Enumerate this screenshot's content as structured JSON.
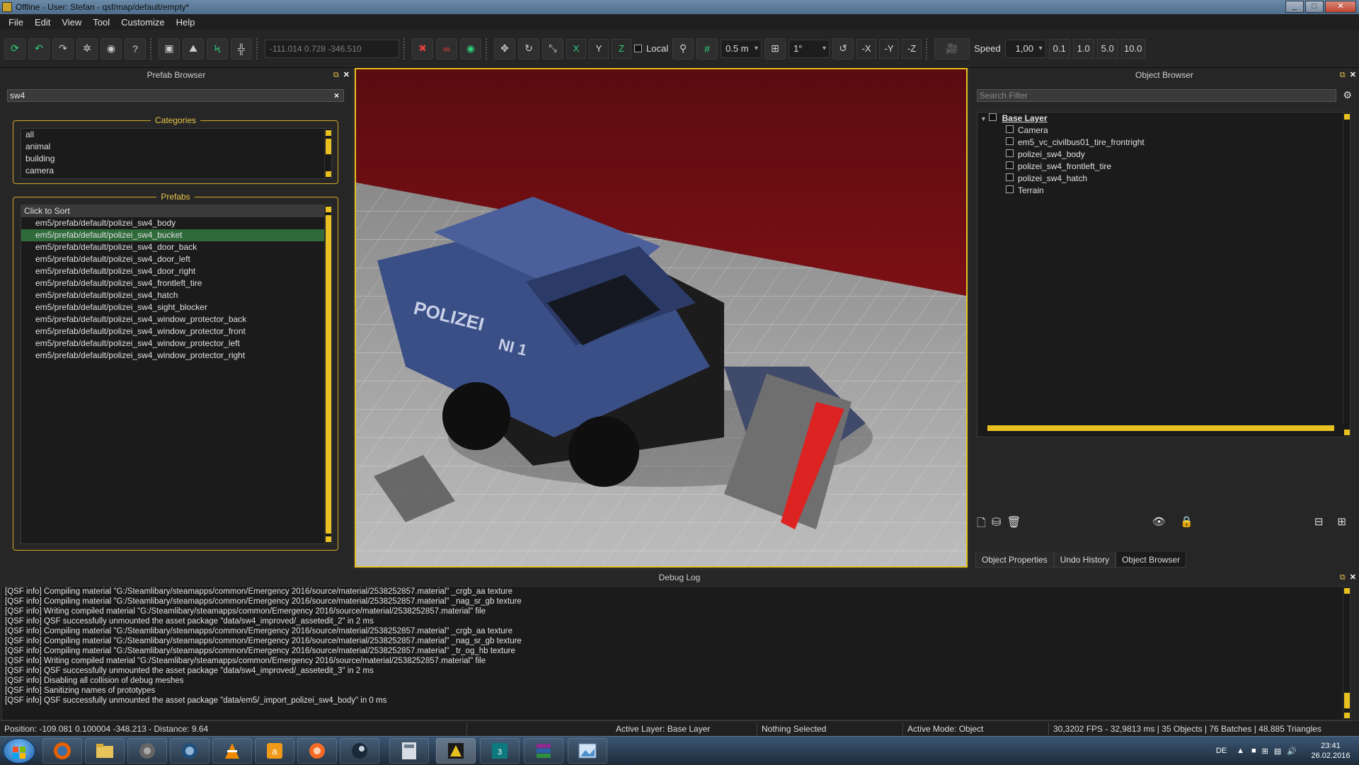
{
  "window": {
    "title": "Offline - User: Stefan - qsf/map/default/empty*",
    "minimize": "_",
    "maximize": "□",
    "close": "✕"
  },
  "menu": [
    "File",
    "Edit",
    "View",
    "Tool",
    "Customize",
    "Help"
  ],
  "toolbar": {
    "coordinates": "-111.014 0.728 -346.510",
    "axis_x": "X",
    "axis_y": "Y",
    "axis_z": "Z",
    "local_label": "Local",
    "grid_size": "0.5 m",
    "angle_snap": "1°",
    "neg_x": "-X",
    "neg_y": "-Y",
    "neg_z": "-Z",
    "speed_label": "Speed",
    "speed_value": "1,00",
    "speed_presets": [
      "0.1",
      "1.0",
      "5.0",
      "10.0"
    ]
  },
  "prefab_browser": {
    "title": "Prefab Browser",
    "search_value": "sw4",
    "categories_label": "Categories",
    "categories": [
      "all",
      "animal",
      "building",
      "camera"
    ],
    "prefabs_label": "Prefabs",
    "sort_header": "Click to Sort",
    "prefabs": [
      "em5/prefab/default/polizei_sw4_body",
      "em5/prefab/default/polizei_sw4_bucket",
      "em5/prefab/default/polizei_sw4_door_back",
      "em5/prefab/default/polizei_sw4_door_left",
      "em5/prefab/default/polizei_sw4_door_right",
      "em5/prefab/default/polizei_sw4_frontleft_tire",
      "em5/prefab/default/polizei_sw4_hatch",
      "em5/prefab/default/polizei_sw4_sight_blocker",
      "em5/prefab/default/polizei_sw4_window_protector_back",
      "em5/prefab/default/polizei_sw4_window_protector_front",
      "em5/prefab/default/polizei_sw4_window_protector_left",
      "em5/prefab/default/polizei_sw4_window_protector_right"
    ],
    "selected_index": 1
  },
  "viewport": {
    "vehicle_text": "POLIZEI",
    "plate_text": "NI 1"
  },
  "object_browser": {
    "title": "Object Browser",
    "search_placeholder": "Search Filter",
    "layer": "Base Layer",
    "objects": [
      "Camera",
      "em5_vc_civilbus01_tire_frontright",
      "polizei_sw4_body",
      "polizei_sw4_frontleft_tire",
      "polizei_sw4_hatch",
      "Terrain"
    ]
  },
  "tabs": [
    "Object Properties",
    "Undo History",
    "Object Browser"
  ],
  "debug_log": {
    "title": "Debug Log",
    "lines": [
      "[QSF info] Compiling material \"G:/Steamlibary/steamapps/common/Emergency 2016/source/material/2538252857.material\" _crgb_aa texture",
      "[QSF info] Compiling material \"G:/Steamlibary/steamapps/common/Emergency 2016/source/material/2538252857.material\" _nag_sr_gb texture",
      "[QSF info] Writing compiled material \"G:/Steamlibary/steamapps/common/Emergency 2016/source/material/2538252857.material\" file",
      "[QSF info] QSF successfully unmounted the asset package \"data/sw4_improved/_assetedit_2\" in 2 ms",
      "[QSF info] Compiling material \"G:/Steamlibary/steamapps/common/Emergency 2016/source/material/2538252857.material\" _crgb_aa texture",
      "[QSF info] Compiling material \"G:/Steamlibary/steamapps/common/Emergency 2016/source/material/2538252857.material\" _nag_sr_gb texture",
      "[QSF info] Compiling material \"G:/Steamlibary/steamapps/common/Emergency 2016/source/material/2538252857.material\" _tr_og_hb texture",
      "[QSF info] Writing compiled material \"G:/Steamlibary/steamapps/common/Emergency 2016/source/material/2538252857.material\" file",
      "[QSF info] QSF successfully unmounted the asset package \"data/sw4_improved/_assetedit_3\" in 2 ms",
      "[QSF info] Disabling all collision of debug meshes",
      "[QSF info] Sanitizing names of prototypes",
      "[QSF info] QSF successfully unmounted the asset package \"data/em5/_import_polizei_sw4_body\" in 0 ms"
    ]
  },
  "status": {
    "position": "Position: -109.081 0.100004 -348.213 - Distance: 9.64",
    "layer": "Active Layer: Base Layer",
    "selection": "Nothing Selected",
    "mode": "Active Mode: Object",
    "stats": "30,3202 FPS - 32,9813 ms | 35 Objects | 76 Batches | 48.885 Triangles"
  },
  "taskbar": {
    "language": "DE",
    "time": "23:41",
    "date": "26.02.2016"
  },
  "colors": {
    "accent": "#e8c020",
    "selection": "#2f6a3a",
    "viewport_red": "#8c0f14"
  }
}
